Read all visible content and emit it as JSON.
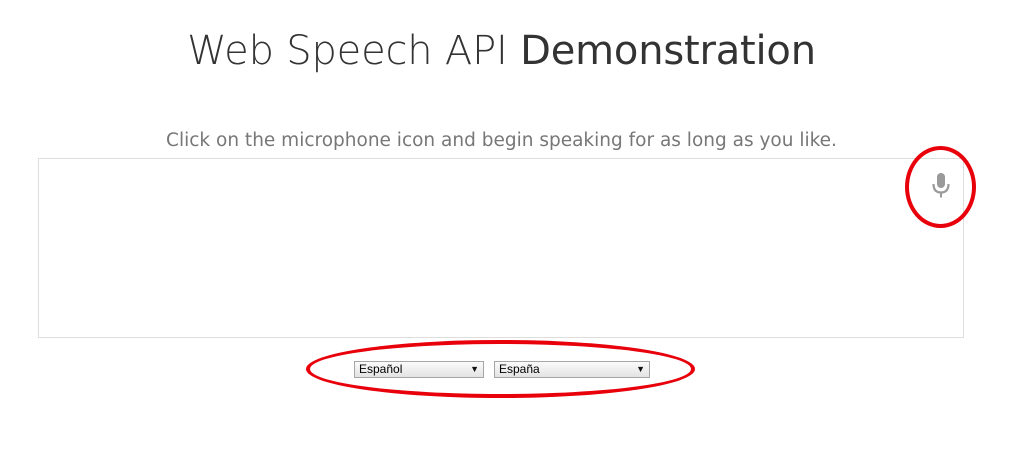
{
  "header": {
    "title_part_a": "Web Speech API",
    "title_part_b": "Demonstration"
  },
  "info": {
    "instructions": "Click on the microphone icon and begin speaking for as long as you like."
  },
  "results": {
    "transcript": ""
  },
  "controls": {
    "mic_icon": "microphone-icon",
    "language_select": {
      "selected": "Español"
    },
    "dialect_select": {
      "selected": "España"
    }
  },
  "annotations": {
    "color": "#e8000b"
  }
}
